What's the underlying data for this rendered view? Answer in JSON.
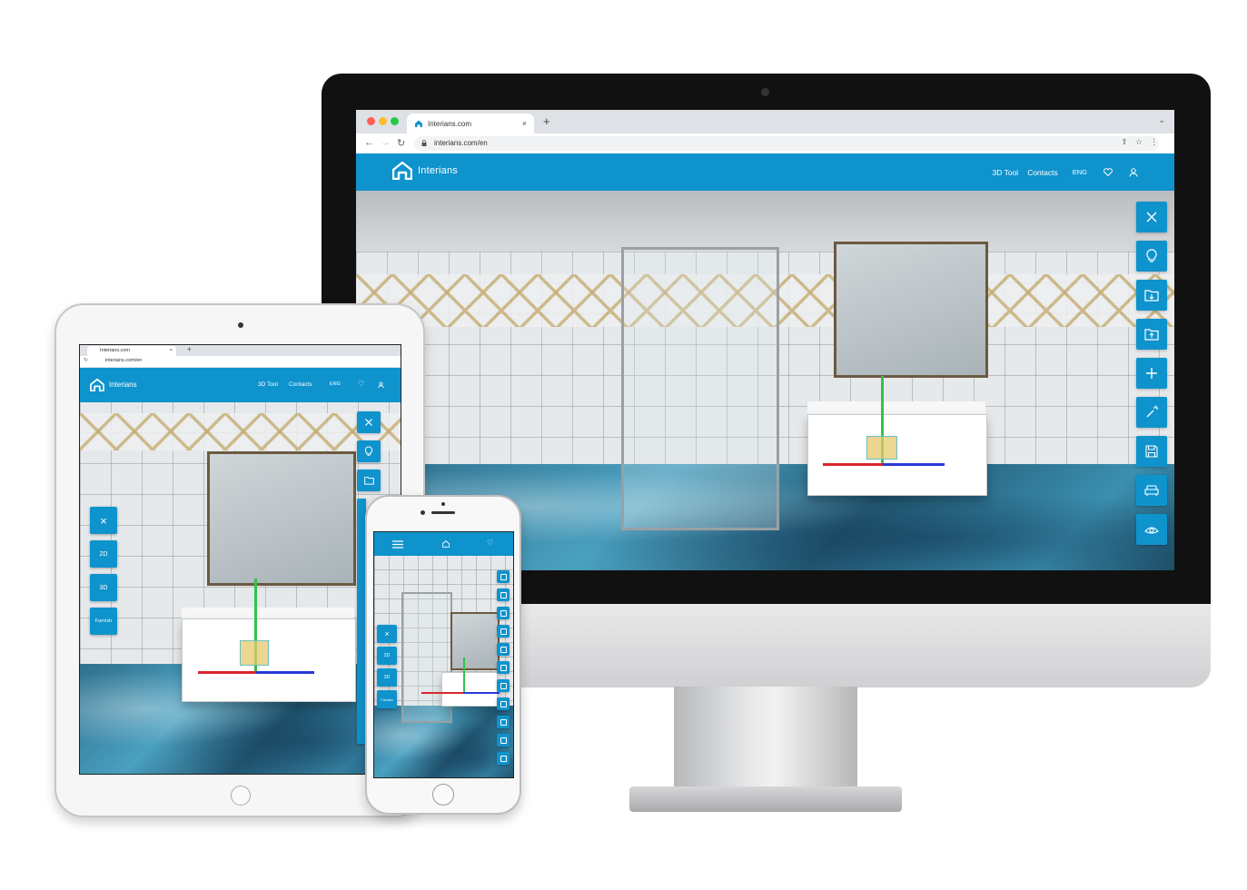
{
  "brand": {
    "name": "Interians",
    "primary_color": "#0f93cd"
  },
  "browser": {
    "tab_title": "Interians.com",
    "tab_close": "×",
    "new_tab": "+",
    "url": "interians.com/en",
    "tablet_url": "interians.com/en"
  },
  "nav": {
    "tool": "3D Tool",
    "contacts": "Contacts",
    "language": "ENG"
  },
  "toolbar_icons": [
    "close-icon",
    "lightbulb-icon",
    "folder-download-icon",
    "folder-upload-icon",
    "plus-icon",
    "magic-wand-icon",
    "save-icon",
    "sofa-icon",
    "eye-icon"
  ],
  "view_modes": {
    "close": "×",
    "two_d": "2D",
    "three_d": "3D",
    "furnish": "Furnish"
  }
}
